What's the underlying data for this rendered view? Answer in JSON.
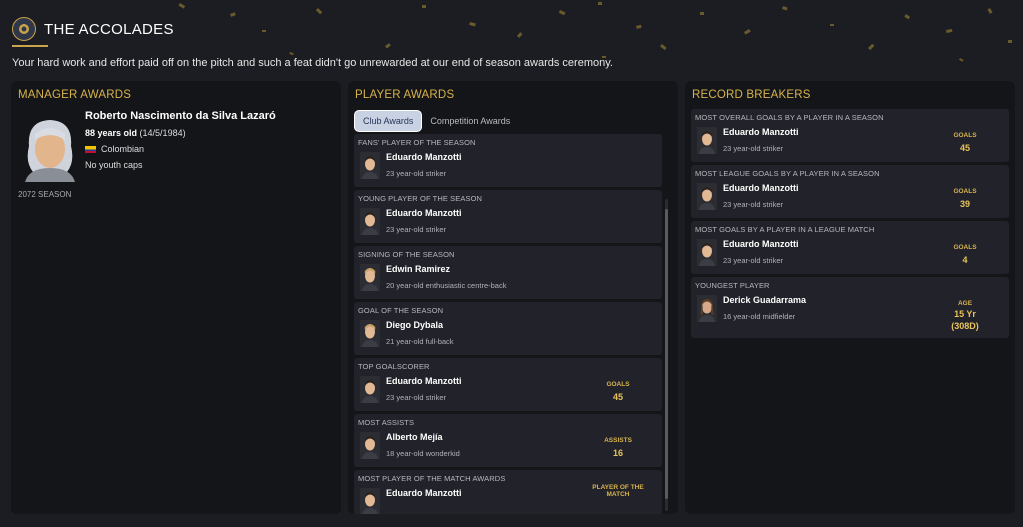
{
  "header": {
    "title": "THE ACCOLADES",
    "subtitle": "Your hard work and effort paid off on the pitch and such a feat didn't go unrewarded at our end of season awards ceremony."
  },
  "colors": {
    "accent": "#d8b34c",
    "panel": "#141519",
    "card": "#22232a",
    "tab_active": "#c8d2e3"
  },
  "manager": {
    "heading": "MANAGER AWARDS",
    "name": "Roberto Nascimento da Silva Lazaró",
    "age_bold": "88 years old",
    "dob": "(14/5/1984)",
    "nationality": "Colombian",
    "caps": "No youth caps",
    "season": "2072 SEASON"
  },
  "player_awards": {
    "heading": "PLAYER AWARDS",
    "tabs": [
      "Club Awards",
      "Competition Awards"
    ],
    "active_tab": "Club Awards",
    "items": [
      {
        "award": "FANS' PLAYER OF THE SEASON",
        "name": "Eduardo Manzotti",
        "desc": "23 year-old striker",
        "stat_label": "",
        "stat_value": ""
      },
      {
        "award": "YOUNG PLAYER OF THE SEASON",
        "name": "Eduardo Manzotti",
        "desc": "23 year-old striker",
        "stat_label": "",
        "stat_value": ""
      },
      {
        "award": "SIGNING OF THE SEASON",
        "name": "Edwin Ramirez",
        "desc": "20 year-old enthusiastic centre-back",
        "stat_label": "",
        "stat_value": ""
      },
      {
        "award": "GOAL OF THE SEASON",
        "name": "Diego Dybala",
        "desc": "21 year-old full-back",
        "stat_label": "",
        "stat_value": ""
      },
      {
        "award": "TOP GOALSCORER",
        "name": "Eduardo Manzotti",
        "desc": "23 year-old striker",
        "stat_label": "GOALS",
        "stat_value": "45"
      },
      {
        "award": "MOST ASSISTS",
        "name": "Alberto Mejía",
        "desc": "18 year-old wonderkid",
        "stat_label": "ASSISTS",
        "stat_value": "16"
      },
      {
        "award": "MOST PLAYER OF THE MATCH AWARDS",
        "name": "Eduardo Manzotti",
        "desc": "",
        "stat_label": "PLAYER OF THE MATCH",
        "stat_value": ""
      }
    ]
  },
  "record_breakers": {
    "heading": "RECORD BREAKERS",
    "items": [
      {
        "record": "MOST OVERALL GOALS BY A PLAYER IN A SEASON",
        "name": "Eduardo Manzotti",
        "desc": "23 year-old striker",
        "stat_label": "GOALS",
        "stat_value": "45"
      },
      {
        "record": "MOST LEAGUE GOALS BY A PLAYER IN A SEASON",
        "name": "Eduardo Manzotti",
        "desc": "23 year-old striker",
        "stat_label": "GOALS",
        "stat_value": "39"
      },
      {
        "record": "MOST GOALS BY A PLAYER IN A LEAGUE MATCH",
        "name": "Eduardo Manzotti",
        "desc": "23 year-old striker",
        "stat_label": "GOALS",
        "stat_value": "4"
      },
      {
        "record": "YOUNGEST PLAYER",
        "name": "Derick Guadarrama",
        "desc": "16 year-old midfielder",
        "stat_label": "AGE",
        "stat_value": "15 Yr (308D)"
      }
    ]
  }
}
